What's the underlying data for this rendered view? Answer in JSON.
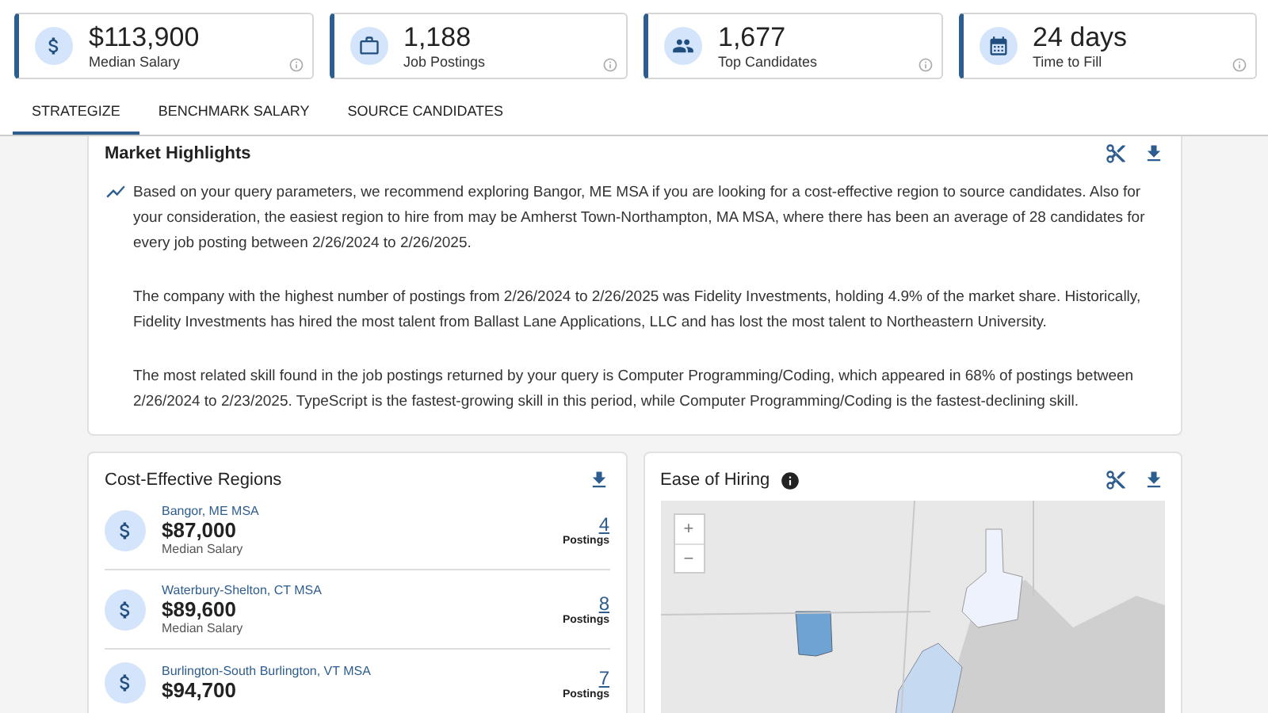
{
  "stats": [
    {
      "kind": "salary",
      "value": "$113,900",
      "label": "Median Salary"
    },
    {
      "kind": "postings",
      "value": "1,188",
      "label": "Job Postings"
    },
    {
      "kind": "candidates",
      "value": "1,677",
      "label": "Top Candidates"
    },
    {
      "kind": "time",
      "value": "24 days",
      "label": "Time to Fill"
    }
  ],
  "tabs": [
    {
      "label": "STRATEGIZE",
      "selected": true
    },
    {
      "label": "BENCHMARK SALARY",
      "selected": false
    },
    {
      "label": "SOURCE CANDIDATES",
      "selected": false
    }
  ],
  "market_highlights": {
    "title": "Market Highlights",
    "paragraphs": [
      "Based on your query parameters, we recommend exploring Bangor, ME MSA if you are looking for a cost-effective region to source candidates. Also for your consideration, the easiest region to hire from may be Amherst Town-Northampton, MA MSA, where there has been an average of 28 candidates for every job posting between 2/26/2024 to 2/26/2025.",
      "The company with the highest number of postings from 2/26/2024 to 2/26/2025 was Fidelity Investments, holding 4.9% of the market share. Historically, Fidelity Investments has hired the most talent from Ballast Lane Applications, LLC and has lost the most talent to Northeastern University.",
      "The most related skill found in the job postings returned by your query is Computer Programming/Coding, which appeared in 68% of postings between 2/26/2024 to 2/23/2025. TypeScript is the fastest-growing skill in this period, while Computer Programming/Coding is the fastest-declining skill."
    ]
  },
  "cost_effective_regions": {
    "title": "Cost-Effective Regions",
    "regions": [
      {
        "name": "Bangor, ME MSA",
        "salary": "$87,000",
        "salary_label": "Median Salary",
        "postings": "4",
        "postings_label": "Postings"
      },
      {
        "name": "Waterbury-Shelton, CT MSA",
        "salary": "$89,600",
        "salary_label": "Median Salary",
        "postings": "8",
        "postings_label": "Postings"
      },
      {
        "name": "Burlington-South Burlington, VT MSA",
        "salary": "$94,700",
        "postings": "7",
        "postings_label": "Postings"
      }
    ]
  },
  "ease_of_hiring": {
    "title": "Ease of Hiring",
    "zoom_controls": [
      "+",
      "−"
    ]
  }
}
